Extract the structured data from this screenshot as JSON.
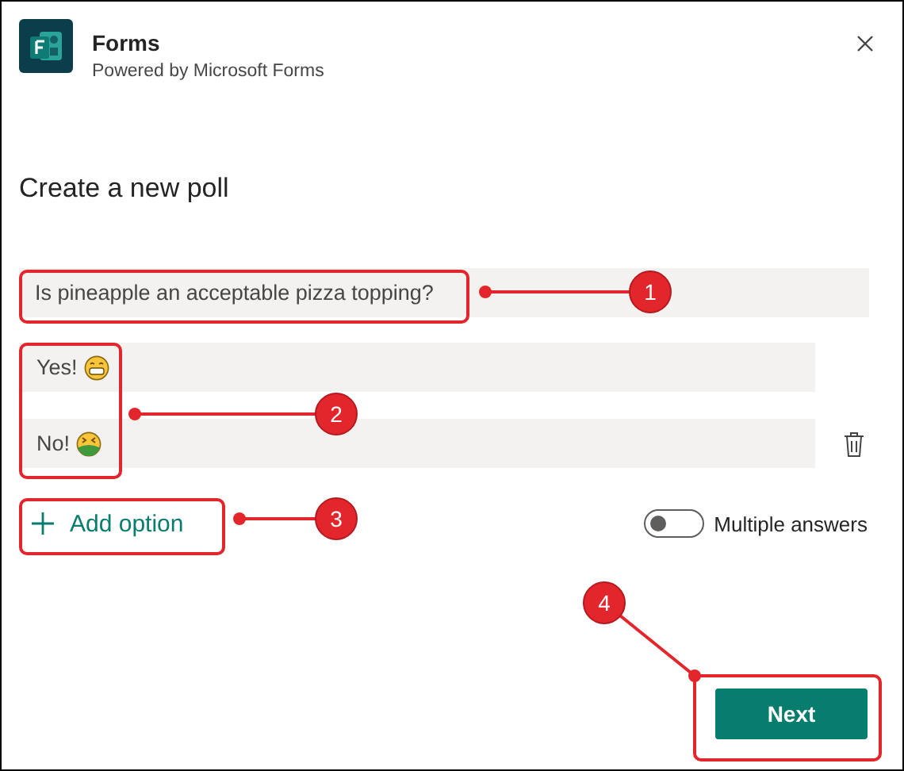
{
  "app": {
    "title": "Forms",
    "subtitle": "Powered by Microsoft Forms"
  },
  "heading": "Create a new poll",
  "question": {
    "value": "Is pineapple an acceptable pizza topping?"
  },
  "options": [
    {
      "value": "Yes!",
      "kind": "grin",
      "deletable": false
    },
    {
      "value": "No!",
      "kind": "sick",
      "deletable": true
    }
  ],
  "add_option": "Add option",
  "multiple_answers": {
    "label": "Multiple answers",
    "on": false
  },
  "next_button": "Next",
  "annotations": [
    {
      "number": "1"
    },
    {
      "number": "2"
    },
    {
      "number": "3"
    },
    {
      "number": "4"
    }
  ]
}
